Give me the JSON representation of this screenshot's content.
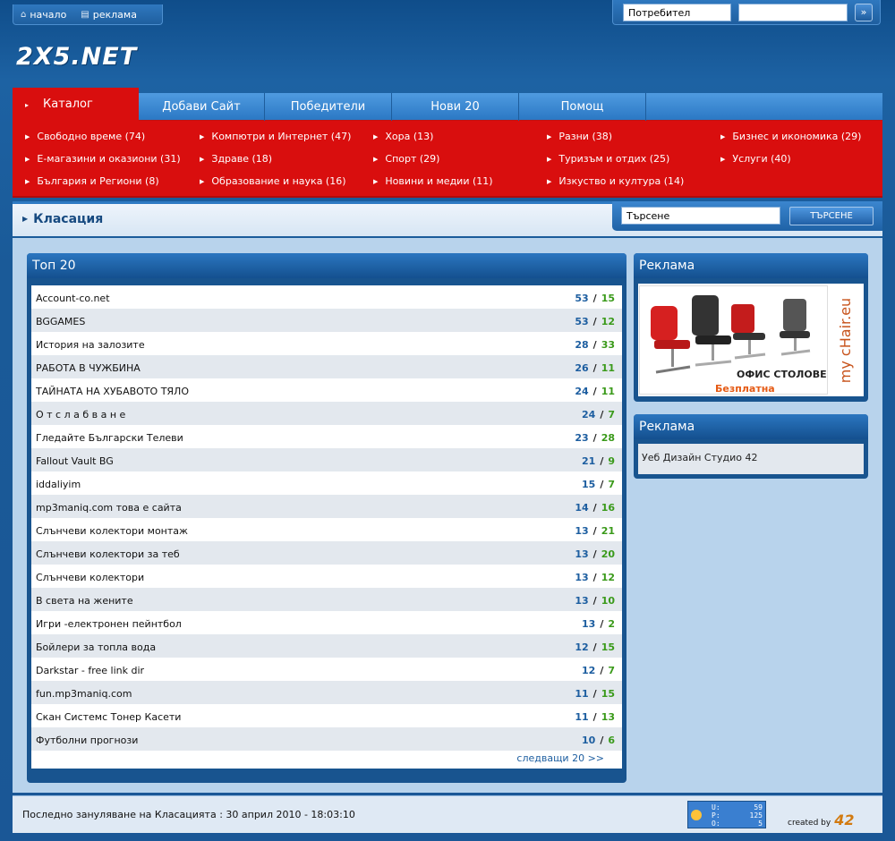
{
  "topnav": {
    "home": "начало",
    "ads": "реклама"
  },
  "login": {
    "username_value": "Потребител",
    "password_value": "",
    "go": "»"
  },
  "logo": "2X5.NET",
  "tabs": [
    "Каталог",
    "Добави Сайт",
    "Победители",
    "Нови 20",
    "Помощ"
  ],
  "categories": [
    [
      "Свободно време (74)",
      "Е-магазини и оказиони (31)",
      "България и Региони (8)"
    ],
    [
      "Компютри и Интернет (47)",
      "Здраве (18)",
      "Образование и наука (16)"
    ],
    [
      "Хора (13)",
      "Спорт (29)",
      "Новини и медии (11)"
    ],
    [
      "Разни (38)",
      "Туризъм и отдих (25)",
      "Изкуство и култура (14)"
    ],
    [
      "Бизнес и икономика (29)",
      "Услуги (40)"
    ]
  ],
  "ranking": {
    "title": "Класация",
    "search_value": "Търсене",
    "search_button": "ТЪРСЕНЕ"
  },
  "top20": {
    "title": "Топ 20",
    "rows": [
      {
        "name": "Account-co.net",
        "a": "53",
        "b": "15"
      },
      {
        "name": "BGGAMES",
        "a": "53",
        "b": "12"
      },
      {
        "name": "История на залозите",
        "a": "28",
        "b": "33"
      },
      {
        "name": "РАБОТА В ЧУЖБИНА",
        "a": "26",
        "b": "11"
      },
      {
        "name": "ТАЙНАТА НА ХУБАВОТО ТЯЛО",
        "a": "24",
        "b": "11"
      },
      {
        "name": "О т с л а б в а н е",
        "a": "24",
        "b": "7"
      },
      {
        "name": "Гледайте Български Телеви",
        "a": "23",
        "b": "28"
      },
      {
        "name": "Fallout Vault BG",
        "a": "21",
        "b": "9"
      },
      {
        "name": "iddaliyim",
        "a": "15",
        "b": "7"
      },
      {
        "name": "mp3maniq.com това е сайта",
        "a": "14",
        "b": "16"
      },
      {
        "name": "Слънчеви колектори монтаж",
        "a": "13",
        "b": "21"
      },
      {
        "name": "Слънчеви колектори за теб",
        "a": "13",
        "b": "20"
      },
      {
        "name": "Слънчеви колектори",
        "a": "13",
        "b": "12"
      },
      {
        "name": "В света на жените",
        "a": "13",
        "b": "10"
      },
      {
        "name": "Игри -електронен пейнтбол",
        "a": "13",
        "b": "2"
      },
      {
        "name": "Бойлери за топла вода",
        "a": "12",
        "b": "15"
      },
      {
        "name": "Darkstar - free link dir",
        "a": "12",
        "b": "7"
      },
      {
        "name": "fun.mp3maniq.com",
        "a": "11",
        "b": "15"
      },
      {
        "name": "Скан Системс Тонер Касети",
        "a": "11",
        "b": "13"
      },
      {
        "name": "Футболни прогнози",
        "a": "10",
        "b": "6"
      }
    ],
    "next": "следващи 20 >>"
  },
  "ad1": {
    "title": "Реклама",
    "brand": "my cHair.eu",
    "line1": "ОФИС СТОЛОВЕ",
    "line2": "Безплатна доставка"
  },
  "ad2": {
    "title": "Реклама",
    "text": "Уеб Дизайн Студио 42"
  },
  "footer": {
    "text": "Последно зануляване на Класацията : 30 април 2010 - 18:03:10",
    "counter": [
      [
        "U:",
        "59"
      ],
      [
        "P:",
        "125"
      ],
      [
        "O:",
        "5"
      ]
    ],
    "created_by": "created by",
    "studio": "42"
  },
  "colors": {
    "red": "#d90e0e",
    "blue": "#1d5ea0",
    "green": "#3a9a1a"
  }
}
